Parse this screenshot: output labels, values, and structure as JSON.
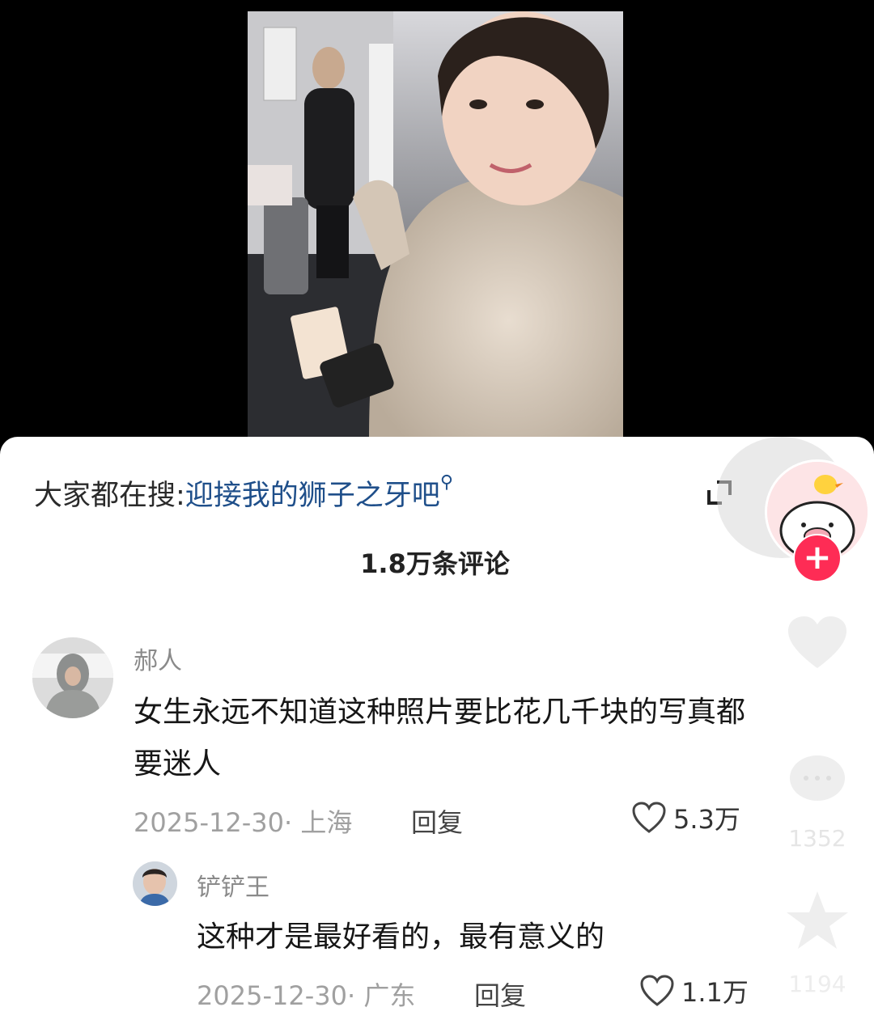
{
  "search_bar": {
    "prefix": "大家都在搜:",
    "term": "迎接我的狮子之牙吧"
  },
  "comments_header": {
    "count_label": "1.8万条评论"
  },
  "side_rail": {
    "comment_count": "1352",
    "favorite_count": "1194"
  },
  "comments": [
    {
      "username": "郝人",
      "text_line1": "女生永远不知道这种照片要比花几千块的写真都",
      "text_line2": "要迷人",
      "date": "2025-12-30",
      "location": "· 上海",
      "reply_label": "回复",
      "likes": "5.3万"
    }
  ],
  "replies": [
    {
      "username": "铲铲王",
      "text": "这种才是最好看的，最有意义的",
      "date": "2025-12-30",
      "location": "· 广东",
      "reply_label": "回复",
      "likes": "1.1万"
    }
  ],
  "colors": {
    "accent": "#fe2c55",
    "link": "#1f4f8a"
  },
  "icons": [
    "expand-icon",
    "plus-icon",
    "heart-icon",
    "comment-icon",
    "star-icon",
    "search-icon"
  ]
}
